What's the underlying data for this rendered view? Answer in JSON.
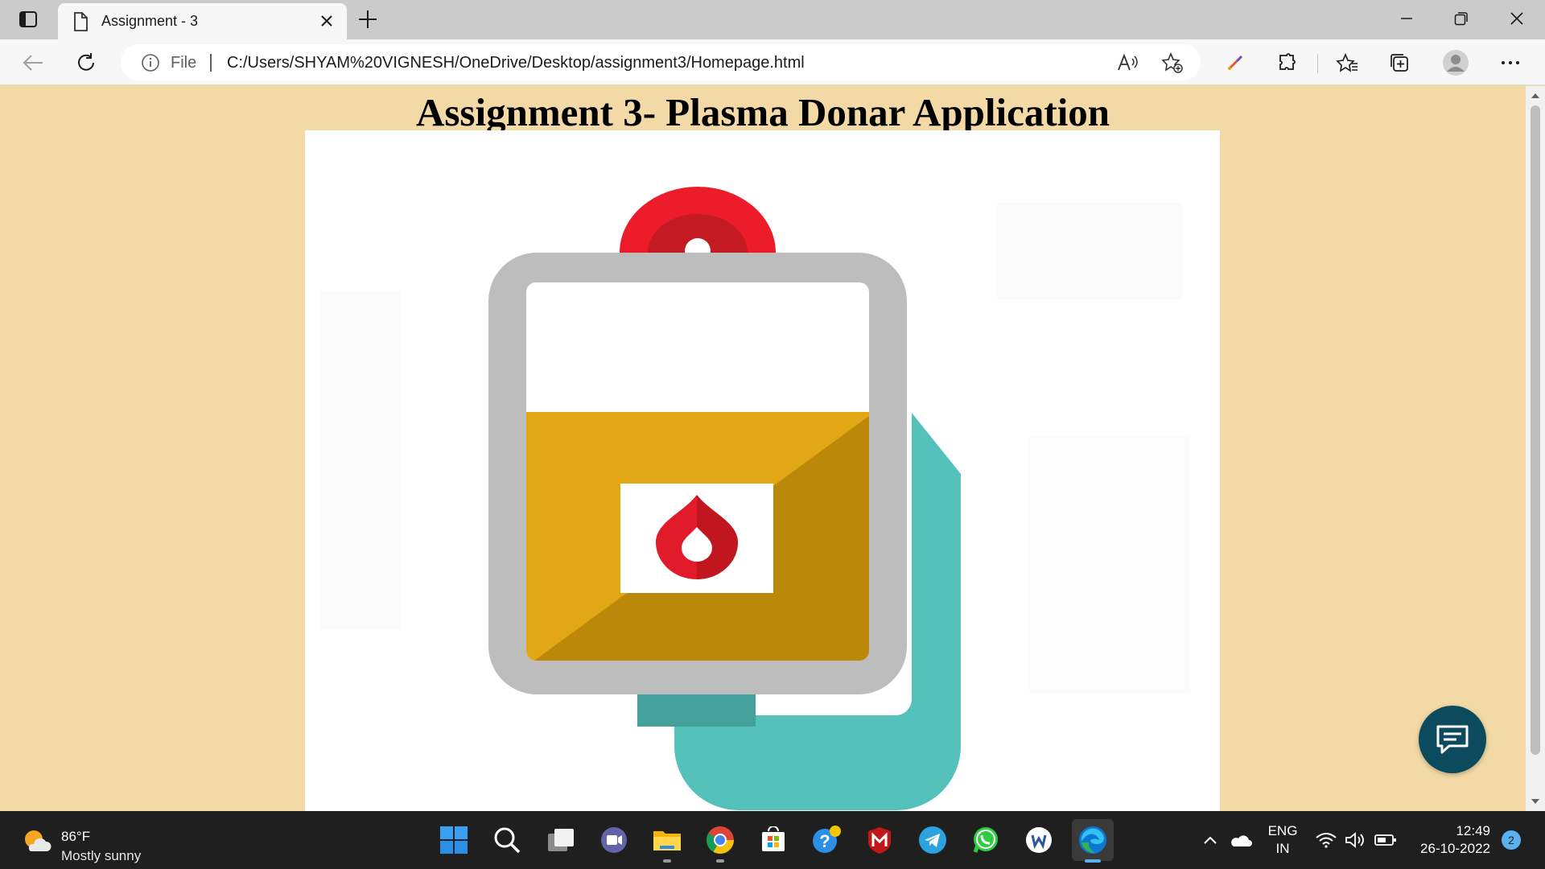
{
  "browser": {
    "tab_title": "Assignment - 3",
    "omnibox_scheme_label": "File",
    "url": "C:/Users/SHYAM%20VIGNESH/OneDrive/Desktop/assignment3/Homepage.html"
  },
  "page": {
    "heading": "Assignment 3- Plasma Donar Application",
    "background_color": "#f2d9a6",
    "hero_image": {
      "icon": "blood-bag-icon",
      "bag_fill_color": "#e2a714",
      "drop_color": "#e21b2a",
      "tube_color": "#54c1bb",
      "frame_color": "#bdbdbd"
    },
    "chat_button_icon": "chat-icon"
  },
  "taskbar": {
    "weather_temp": "86°F",
    "weather_desc": "Mostly sunny",
    "apps": [
      "start-icon",
      "search-icon",
      "task-view-icon",
      "teams-chat-icon",
      "file-explorer-icon",
      "chrome-icon",
      "microsoft-store-icon",
      "get-help-icon",
      "mcafee-icon",
      "telegram-icon",
      "whatsapp-icon",
      "word-icon",
      "edge-icon"
    ],
    "lang_line1": "ENG",
    "lang_line2": "IN",
    "time": "12:49",
    "date": "26-10-2022",
    "notification_count": "2"
  }
}
